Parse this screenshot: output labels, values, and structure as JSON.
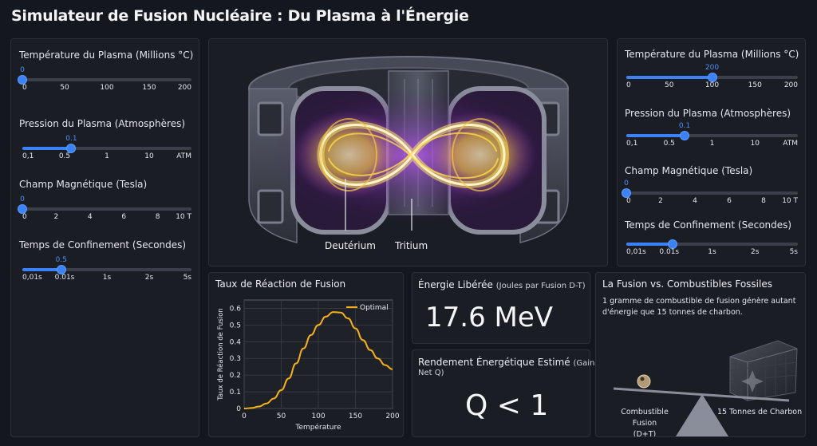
{
  "app": {
    "title": "Simulateur de Fusion Nucléaire : Du Plasma à l'Énergie"
  },
  "left_panel": {
    "temperature": {
      "label": "Température du Plasma (Millions °C)",
      "value": "0",
      "fraction": 0,
      "ticks": [
        "0",
        "50",
        "100",
        "150",
        "200"
      ]
    },
    "pressure": {
      "label": "Pression du Plasma (Atmosphères)",
      "value": "0.1",
      "fraction": 0.29,
      "ticks": [
        "0,1",
        "0.5",
        "1",
        "10",
        "ATM"
      ]
    },
    "magnetic": {
      "label": "Champ Magnétique (Tesla)",
      "value": "0",
      "fraction": 0,
      "ticks": [
        "0",
        "2",
        "4",
        "6",
        "8",
        "10 T"
      ]
    },
    "confinement": {
      "label": "Temps de Confinement (Secondes)",
      "value": "0.5",
      "fraction": 0.23,
      "ticks": [
        "0,01s",
        "0.01s",
        "1s",
        "2s",
        "5s"
      ]
    }
  },
  "right_panel": {
    "temperature": {
      "label": "Température du Plasma (Millions °C)",
      "value": "200",
      "fraction": 0.5,
      "ticks": [
        "0",
        "50",
        "100",
        "150",
        "200"
      ]
    },
    "pressure": {
      "label": "Pression du Plasma (Atmosphères)",
      "value": "0.1",
      "fraction": 0.34,
      "ticks": [
        "0,1",
        "0.5",
        "1",
        "10",
        "ATM"
      ]
    },
    "magnetic": {
      "label": "Champ Magnétique (Tesla)",
      "value": "0",
      "fraction": 0,
      "ticks": [
        "0",
        "2",
        "4",
        "6",
        "8",
        "10 T"
      ]
    },
    "confinement": {
      "label": "Temps de Confinement (Secondes)",
      "value": "",
      "fraction": 0.27,
      "ticks": [
        "0,01s",
        "0.01s",
        "1s",
        "2s",
        "5s"
      ]
    }
  },
  "reactor": {
    "label_deuterium": "Deutérium",
    "label_tritium": "Tritium"
  },
  "reaction_chart": {
    "card_title": "Taux de Réaction de Fusion"
  },
  "chart_data": {
    "type": "line",
    "title": "",
    "xlabel": "Température",
    "ylabel": "Taux de Réaction de Fusion",
    "xlim": [
      0,
      200
    ],
    "ylim": [
      0,
      0.65
    ],
    "xticks": [
      "0",
      "50",
      "100",
      "150",
      "200"
    ],
    "yticks": [
      "0",
      "0.1",
      "0.2",
      "0.3",
      "0.4",
      "0.5",
      "0.6"
    ],
    "grid": true,
    "legend_position": "top-right",
    "color": "#f5b11a",
    "series": [
      {
        "name": "Optimal",
        "x": [
          0,
          10,
          20,
          30,
          40,
          50,
          60,
          70,
          80,
          90,
          100,
          110,
          120,
          130,
          140,
          150,
          160,
          170,
          180,
          190,
          200
        ],
        "y": [
          0.0,
          0.003,
          0.012,
          0.03,
          0.06,
          0.11,
          0.18,
          0.27,
          0.36,
          0.44,
          0.5,
          0.55,
          0.578,
          0.575,
          0.54,
          0.48,
          0.41,
          0.35,
          0.3,
          0.26,
          0.235
        ]
      }
    ]
  },
  "energy_card": {
    "title": "Énergie Libérée",
    "subtitle": "(Joules par Fusion D-T)",
    "value": "17.6 MeV"
  },
  "yield_card": {
    "title_main": "Rendement Énergétique Estimé",
    "title_paren": "(Gain",
    "title_line2": "Net Q)",
    "value": "Q < 1"
  },
  "comparison_card": {
    "title": "La Fusion vs. Combustibles Fossiles",
    "text_line1": "1 gramme de combustible de fusion génère autant",
    "text_line2": "d'énergie que 15 tonnes de charbon.",
    "label_fusion_line1": "Combustible Fusion",
    "label_fusion_line2": "(D+T)",
    "label_coal": "15 Tonnes de Charbon"
  }
}
